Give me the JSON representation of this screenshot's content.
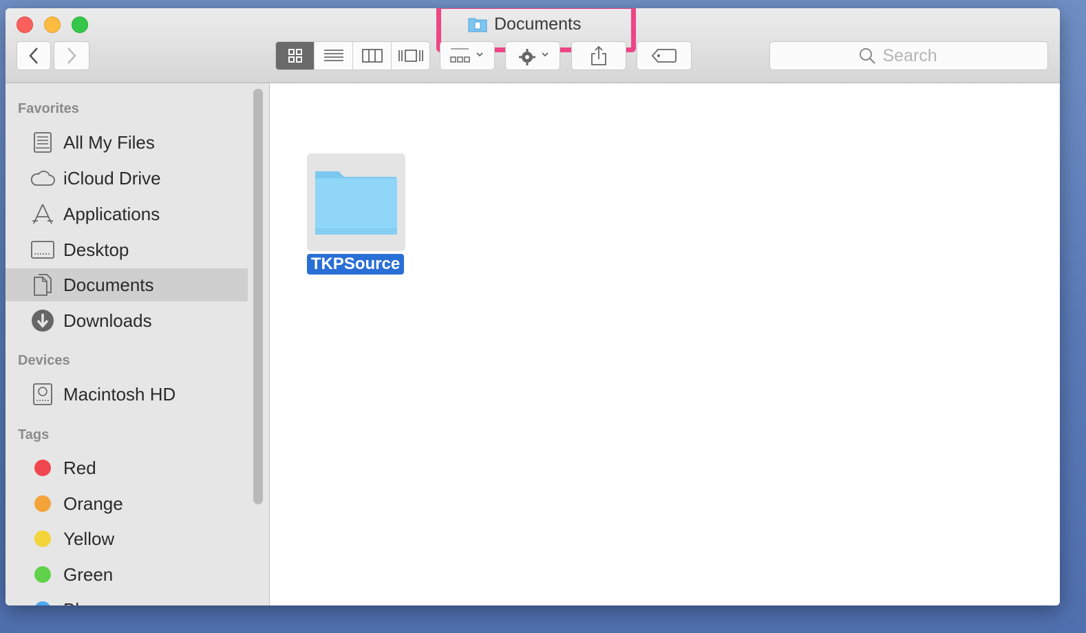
{
  "window": {
    "title": "Documents"
  },
  "toolbar": {
    "back_icon": "chevron-left-icon",
    "forward_icon": "chevron-right-icon",
    "view_modes": [
      "icon-view",
      "list-view",
      "column-view",
      "cover-flow-view"
    ],
    "active_view": "icon-view",
    "arrange_icon": "arrange-grid-icon",
    "action_icon": "gear-icon",
    "share_icon": "share-icon",
    "tags_icon": "tag-icon",
    "search_placeholder": "Search"
  },
  "sidebar": {
    "favorites_title": "Favorites",
    "favorites": [
      {
        "label": "All My Files",
        "icon": "all-files-icon"
      },
      {
        "label": "iCloud Drive",
        "icon": "cloud-icon"
      },
      {
        "label": "Applications",
        "icon": "applications-icon"
      },
      {
        "label": "Desktop",
        "icon": "desktop-icon"
      },
      {
        "label": "Documents",
        "icon": "documents-icon",
        "selected": true
      },
      {
        "label": "Downloads",
        "icon": "downloads-icon"
      }
    ],
    "devices_title": "Devices",
    "devices": [
      {
        "label": "Macintosh HD",
        "icon": "hard-drive-icon"
      }
    ],
    "tags_title": "Tags",
    "tags": [
      {
        "label": "Red",
        "color": "#f0474f"
      },
      {
        "label": "Orange",
        "color": "#f4a23a"
      },
      {
        "label": "Yellow",
        "color": "#f3d43a"
      },
      {
        "label": "Green",
        "color": "#5fd24a"
      },
      {
        "label": "Blue",
        "color": "#4aa8f0"
      }
    ]
  },
  "content": {
    "items": [
      {
        "name": "TKPSource",
        "type": "folder",
        "selected": true
      }
    ]
  },
  "colors": {
    "highlight": "#ef4486",
    "selection": "#2a6fd6"
  }
}
